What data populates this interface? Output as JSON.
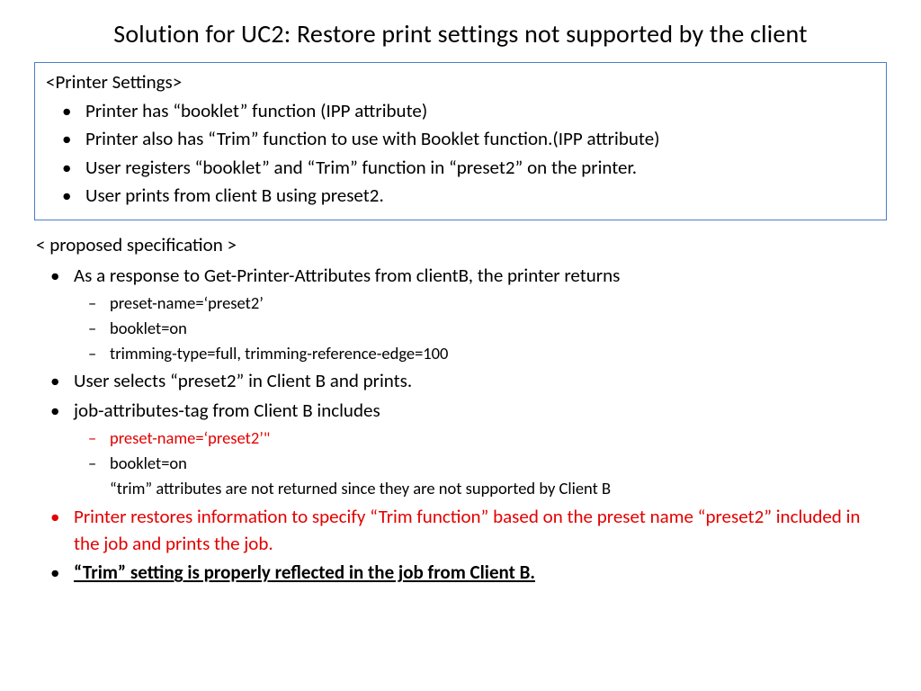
{
  "title": "Solution for UC2: Restore print settings not supported by the client",
  "box": {
    "label": "<Printer Settings>",
    "items": [
      "Printer has “booklet” function (IPP attribute)",
      "Printer also has “Trim” function to use with Booklet function.(IPP attribute)",
      "User registers “booklet” and “Trim” function in “preset2” on the printer.",
      "User prints from client B using preset2."
    ]
  },
  "proposed": {
    "label": "< proposed specification >",
    "li1": "As a response to Get-Printer-Attributes from clientB, the printer returns",
    "li1_sub": [
      "preset-name=‘preset2’",
      "booklet=on",
      "trimming-type=full, trimming-reference-edge=100"
    ],
    "li2": "User selects “preset2” in Client B and prints.",
    "li3": "job-attributes-tag from Client B includes",
    "li3_sub_red": "preset-name=‘preset2’\"",
    "li3_sub2": "booklet=on",
    "li3_note": "“trim” attributes are not returned since they are not supported by Client B",
    "li4": "Printer restores information to specify “Trim function” based on the preset name “preset2” included in the job and prints the job.",
    "li5": "“Trim” setting is properly reflected in the job from Client B."
  }
}
